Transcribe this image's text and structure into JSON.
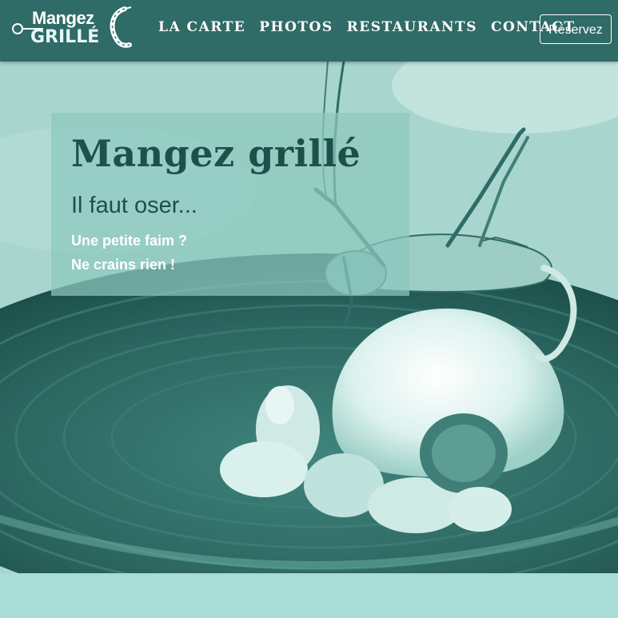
{
  "brand": {
    "name_line1": "Mangez",
    "name_line2": "GRILLÉ",
    "colors": {
      "header_bg": "#2f6b67",
      "hero_tint": "#6aa9a0",
      "bottom_band": "#a9dcd4",
      "title_text": "#1f4f4b"
    }
  },
  "nav": {
    "items": [
      {
        "label": "LA CARTE"
      },
      {
        "label": "PHOTOS"
      },
      {
        "label": "RESTAURANTS"
      },
      {
        "label": "CONTACT"
      }
    ],
    "cta_label": "Réservez"
  },
  "hero": {
    "title": "Mangez grillé",
    "subtitle": "Il faut oser...",
    "line1": "Une petite faim ?",
    "line2": "Ne crains rien !"
  }
}
